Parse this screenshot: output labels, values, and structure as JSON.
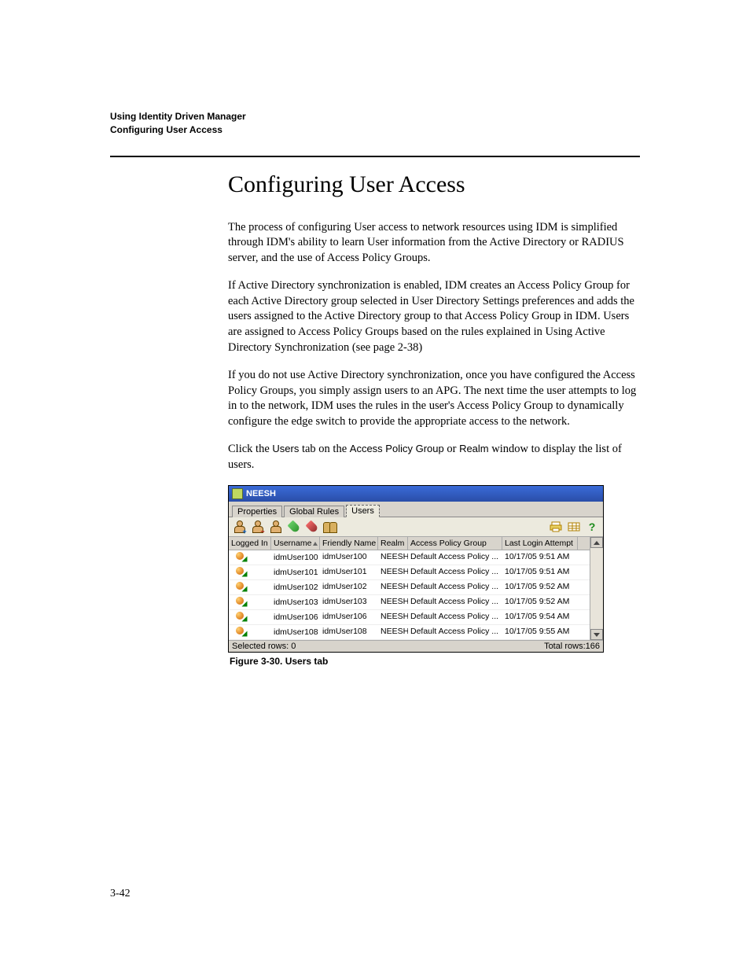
{
  "running_header": {
    "line1": "Using Identity Driven Manager",
    "line2": "Configuring User Access"
  },
  "section_title": "Configuring User Access",
  "paragraphs": {
    "p1": "The process of configuring User access to network resources using IDM is simplified through IDM's ability to learn User information from the Active Directory or RADIUS server, and the use of Access Policy Groups.",
    "p2": "If Active Directory synchronization is enabled, IDM creates an Access Policy Group for each Active Directory group selected in User Directory Settings preferences and adds the users assigned to the Active Directory group to that Access Policy Group in IDM. Users are assigned to Access Policy Groups based on the rules explained in Using Active Directory Synchronization (see page 2-38)",
    "p3": "If you do not use Active Directory synchronization, once you have configured the Access Policy Groups, you simply assign users to an APG. The next time the user attempts to log in to the network, IDM uses the rules in the user's Access Policy Group to dynamically configure the edge switch to provide the appropriate access to the network.",
    "p4_pre": "Click the ",
    "p4_t1": "Users",
    "p4_mid": " tab on the ",
    "p4_t2": "Access Policy Group",
    "p4_mid2": " or ",
    "p4_t3": "Realm",
    "p4_post": " window to display the list of users."
  },
  "figure_caption": "Figure 3-30. Users tab",
  "page_number": "3-42",
  "window": {
    "title": "NEESH",
    "tabs": [
      "Properties",
      "Global Rules",
      "Users"
    ],
    "active_tab_index": 2,
    "columns": [
      "Logged In",
      "Username",
      "Friendly Name",
      "Realm",
      "Access Policy Group",
      "Last Login Attempt"
    ],
    "rows": [
      {
        "username": "idmUser100",
        "friendly": "idmUser100",
        "realm": "NEESH",
        "apg": "Default Access Policy ...",
        "last": "10/17/05 9:51 AM"
      },
      {
        "username": "idmUser101",
        "friendly": "idmUser101",
        "realm": "NEESH",
        "apg": "Default Access Policy ...",
        "last": "10/17/05 9:51 AM"
      },
      {
        "username": "idmUser102",
        "friendly": "idmUser102",
        "realm": "NEESH",
        "apg": "Default Access Policy ...",
        "last": "10/17/05 9:52 AM"
      },
      {
        "username": "idmUser103",
        "friendly": "idmUser103",
        "realm": "NEESH",
        "apg": "Default Access Policy ...",
        "last": "10/17/05 9:52 AM"
      },
      {
        "username": "idmUser106",
        "friendly": "idmUser106",
        "realm": "NEESH",
        "apg": "Default Access Policy ...",
        "last": "10/17/05 9:54 AM"
      },
      {
        "username": "idmUser108",
        "friendly": "idmUser108",
        "realm": "NEESH",
        "apg": "Default Access Policy ...",
        "last": "10/17/05 9:55 AM"
      }
    ],
    "status_left": "Selected rows: 0",
    "status_right": "Total rows:166"
  }
}
